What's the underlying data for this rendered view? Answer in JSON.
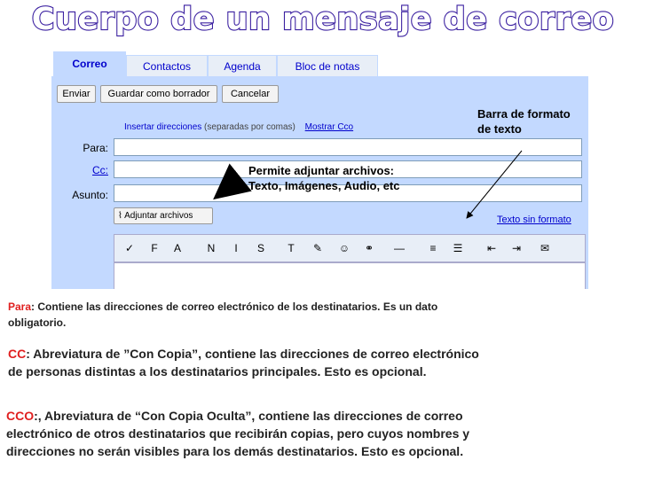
{
  "title": "Cuerpo de un mensaje de correo",
  "tabs": [
    "Correo",
    "Contactos",
    "Agenda",
    "Bloc de notas"
  ],
  "buttons": {
    "send": "Enviar",
    "save_draft": "Guardar como borrador",
    "cancel": "Cancelar"
  },
  "insert_line": {
    "text": "Insertar direcciones",
    "note": "(separadas por comas)",
    "bcc_link": "Mostrar Cco"
  },
  "fields": {
    "to": "Para:",
    "cc": "Cc:",
    "subject": "Asunto:"
  },
  "attach_button": "Adjuntar archivos",
  "plain_text_link": "Texto sin formato",
  "toolbar_icons": [
    "spellcheck-icon",
    "font-icon",
    "font-size-icon",
    "bold-icon",
    "italic-icon",
    "underline-icon",
    "text-color-icon",
    "highlight-icon",
    "emoticon-icon",
    "link-icon",
    "horizontal-rule-icon",
    "numbered-list-icon",
    "bullet-list-icon",
    "outdent-icon",
    "indent-icon",
    "quote-icon"
  ],
  "toolbar_glyphs": [
    "✓",
    "F",
    "A",
    "N",
    "I",
    "S",
    "T",
    "✎",
    "☺",
    "⚭",
    "—",
    "≡",
    "☰",
    "⇤",
    "⇥",
    "✉"
  ],
  "annotations": {
    "format_bar": [
      "Barra de formato",
      "de texto"
    ],
    "attach": [
      "Permite adjuntar archivos:",
      "Texto, Imágenes, Audio, etc"
    ]
  },
  "paragraphs": {
    "para": {
      "term": "Para",
      "lines": [
        ": Contiene las direcciones de correo electrónico de los destinatarios. Es un dato",
        "obligatorio."
      ]
    },
    "cc": {
      "term": "CC",
      "lines": [
        ": Abreviatura de ”Con Copia”, contiene las direcciones de correo electrónico",
        "de personas distintas a los destinatarios principales. Esto es opcional."
      ]
    },
    "cco": {
      "term": "CCO",
      "lines": [
        ":, Abreviatura de “Con Copia Oculta”, contiene las direcciones de correo",
        "electrónico de otros destinatarios que recibirán copias, pero cuyos nombres y",
        "direcciones no serán visibles para los demás destinatarios. Esto es opcional."
      ]
    }
  },
  "colors": {
    "title_outline": "#3a1fa0",
    "panel": "#c3d9ff",
    "term": "#e02020",
    "link": "#0000cc"
  }
}
